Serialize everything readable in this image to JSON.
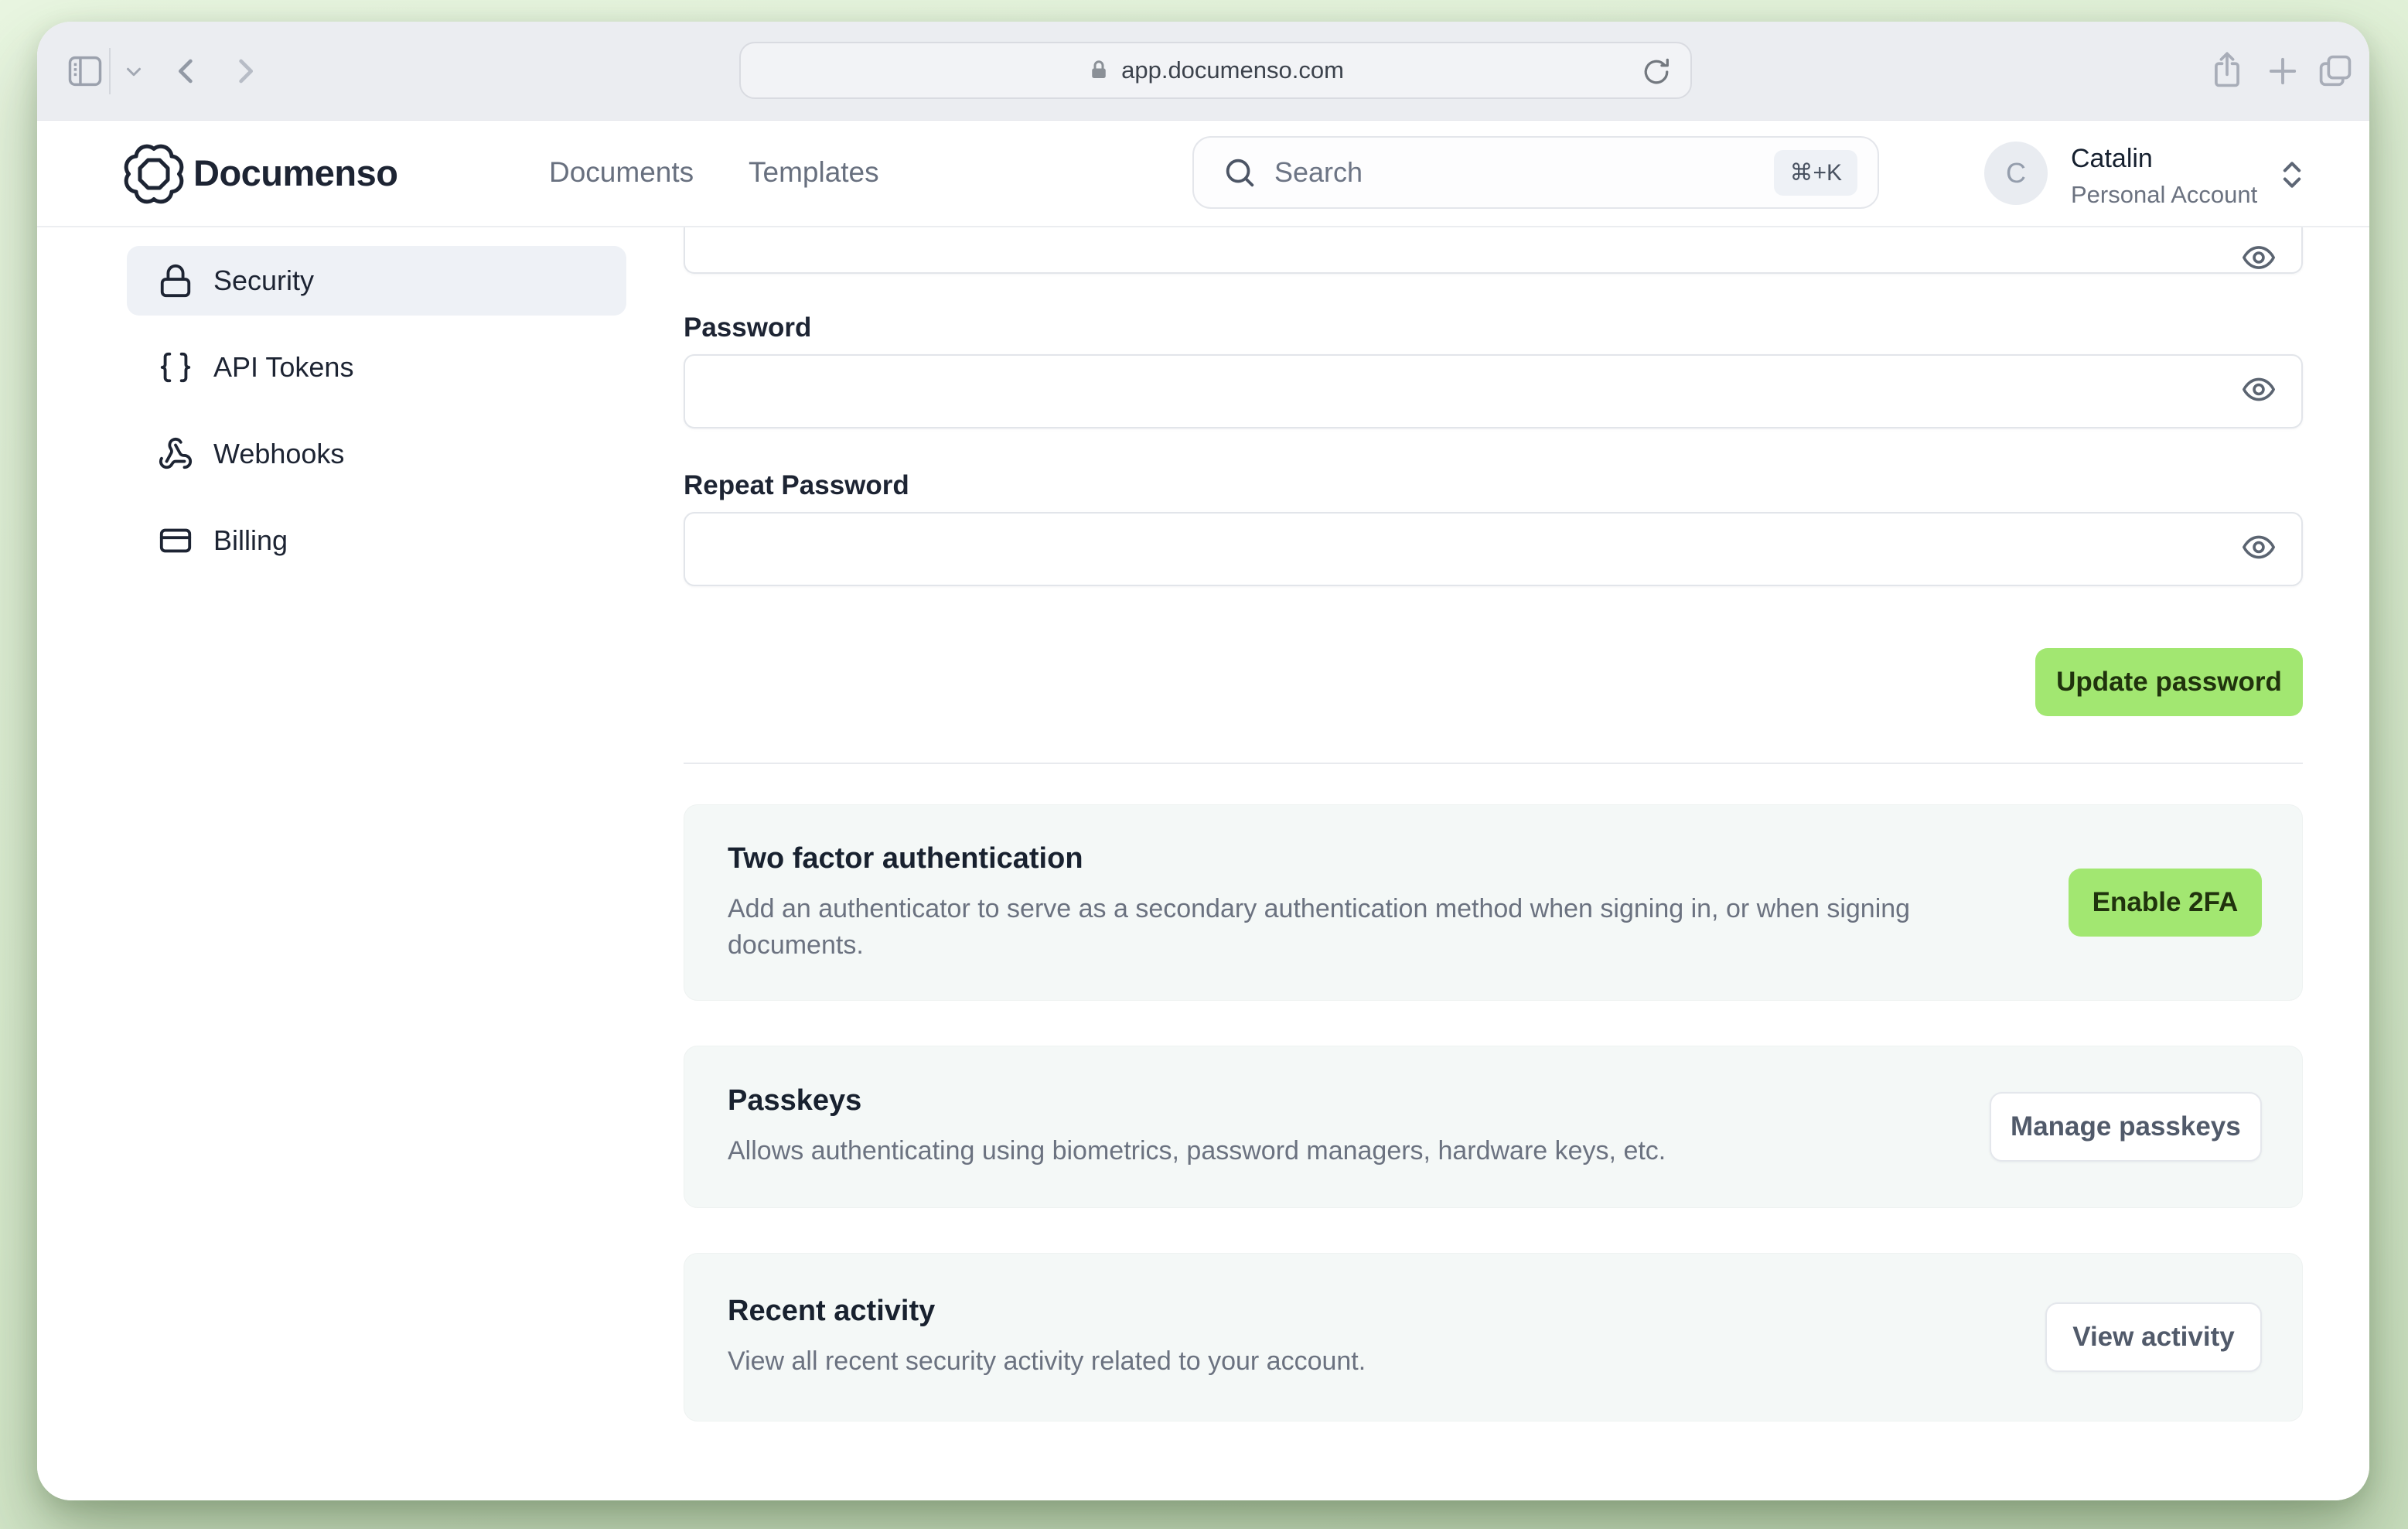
{
  "browser": {
    "url": "app.documenso.com"
  },
  "header": {
    "brand": "Documenso",
    "nav": [
      {
        "label": "Documents"
      },
      {
        "label": "Templates"
      }
    ],
    "search": {
      "placeholder": "Search",
      "shortcut": "⌘+K"
    },
    "account": {
      "initial": "C",
      "name": "Catalin",
      "type": "Personal Account"
    }
  },
  "sidebar": {
    "active": "Security",
    "items": [
      {
        "label": "Security",
        "icon": "lock-icon"
      },
      {
        "label": "API Tokens",
        "icon": "braces-icon"
      },
      {
        "label": "Webhooks",
        "icon": "webhook-icon"
      },
      {
        "label": "Billing",
        "icon": "credit-card-icon"
      }
    ]
  },
  "password_form": {
    "password_label": "Password",
    "repeat_label": "Repeat Password",
    "password_value": "",
    "repeat_value": "",
    "submit_label": "Update password"
  },
  "sections": {
    "two_factor": {
      "title": "Two factor authentication",
      "description": "Add an authenticator to serve as a secondary authentication method when signing in, or when signing documents.",
      "button": "Enable 2FA"
    },
    "passkeys": {
      "title": "Passkeys",
      "description": "Allows authenticating using biometrics, password managers, hardware keys, etc.",
      "button": "Manage passkeys"
    },
    "recent_activity": {
      "title": "Recent activity",
      "description": "View all recent security activity related to your account.",
      "button": "View activity"
    }
  },
  "colors": {
    "accent_green": "#a2e771",
    "accent_green_text": "#20330d",
    "brand_navy": "#1d2433",
    "muted_gray": "#6b7280",
    "active_item_bg": "#eef1f6",
    "card_bg": "#f4f8f7"
  }
}
